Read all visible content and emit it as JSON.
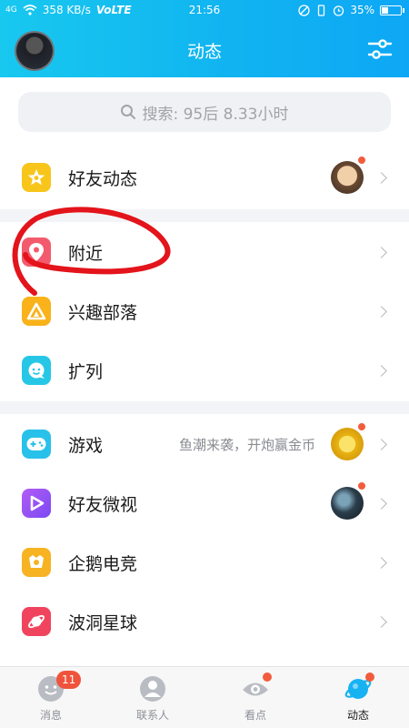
{
  "status_bar": {
    "signal": "4G",
    "net_speed": "358 KB/s",
    "network_tag": "VoLTE",
    "time": "21:56",
    "battery": "35%",
    "battery_level": 0.35
  },
  "header": {
    "title": "动态",
    "avatar_icon": "user-avatar",
    "settings_icon": "sliders-icon"
  },
  "search": {
    "placeholder": "搜索: 95后 8.33小时",
    "icon": "search-icon"
  },
  "sections": [
    {
      "items": [
        {
          "label": "好友动态",
          "icon": "star-icon",
          "icon_color": "#f8c51b",
          "has_thumb": true,
          "has_dot": true
        }
      ]
    },
    {
      "items": [
        {
          "label": "附近",
          "icon": "location-pin-icon",
          "icon_color": "#f45a6d"
        },
        {
          "label": "兴趣部落",
          "icon": "tribe-triangle-icon",
          "icon_color": "#f9b21a"
        },
        {
          "label": "扩列",
          "icon": "chat-smile-icon",
          "icon_color": "#26c7e6"
        }
      ]
    },
    {
      "items": [
        {
          "label": "游戏",
          "icon": "gamepad-icon",
          "icon_color": "#28c1ea",
          "subtitle": "鱼潮来袭，开炮赢金币",
          "has_thumb": true,
          "has_dot": true
        },
        {
          "label": "好友微视",
          "icon": "play-icon",
          "icon_color": "#9b5cf6",
          "has_thumb": true,
          "has_dot": true
        },
        {
          "label": "企鹅电竞",
          "icon": "penguin-esports-icon",
          "icon_color": "#f7b322"
        },
        {
          "label": "波洞星球",
          "icon": "planet-icon",
          "icon_color": "#f0445e"
        }
      ]
    }
  ],
  "tabbar": {
    "tabs": [
      {
        "label": "消息",
        "icon": "message-icon",
        "badge": "11"
      },
      {
        "label": "联系人",
        "icon": "contacts-icon"
      },
      {
        "label": "看点",
        "icon": "eye-icon",
        "dot": true
      },
      {
        "label": "动态",
        "icon": "planet-tab-icon",
        "dot": true,
        "active": true
      }
    ]
  },
  "colors": {
    "header_gradient_start": "#18c8ef",
    "header_gradient_end": "#0ea7f5",
    "annotation_red": "#e3141b"
  }
}
